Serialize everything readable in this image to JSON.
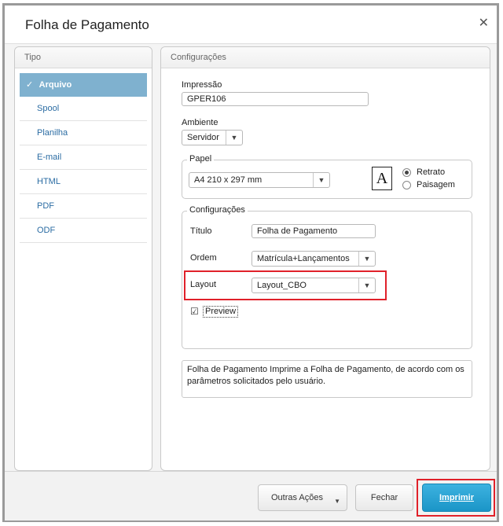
{
  "window": {
    "title": "Folha de Pagamento",
    "close_glyph": "✕"
  },
  "tipo_panel": {
    "header": "Tipo",
    "items": [
      {
        "label": "Arquivo",
        "active": true
      },
      {
        "label": "Spool"
      },
      {
        "label": "Planilha"
      },
      {
        "label": "E-mail"
      },
      {
        "label": "HTML"
      },
      {
        "label": "PDF"
      },
      {
        "label": "ODF"
      }
    ]
  },
  "config_panel": {
    "header": "Configurações",
    "impressao": {
      "label": "Impressão",
      "value": "GPER106"
    },
    "ambiente": {
      "label": "Ambiente",
      "value": "Servidor"
    },
    "papel": {
      "legend": "Papel",
      "value": "A4 210 x 297 mm",
      "doc_icon_letter": "A",
      "orientation": {
        "retrato": "Retrato",
        "paisagem": "Paisagem",
        "selected": "Retrato"
      }
    },
    "configuracoes": {
      "legend": "Configurações",
      "titulo": {
        "label": "Título",
        "value": "Folha de Pagamento"
      },
      "ordem": {
        "label": "Ordem",
        "value": "Matrícula+Lançamentos"
      },
      "layout": {
        "label": "Layout",
        "value": "Layout_CBO"
      },
      "preview": {
        "label": "Preview",
        "checked": true
      }
    },
    "description": "Folha de Pagamento Imprime a Folha de Pagamento, de acordo com os parâmetros solicitados pelo usuário."
  },
  "footer": {
    "outras_acoes": "Outras Ações",
    "fechar": "Fechar",
    "imprimir": "Imprimir"
  },
  "colors": {
    "accent": "#1b95c7",
    "highlight": "#e0212a",
    "active_item": "#7fb1cf"
  },
  "icons": {
    "check": "check-icon",
    "caret": "chevron-down-icon",
    "close": "close-icon",
    "document": "document-icon"
  }
}
